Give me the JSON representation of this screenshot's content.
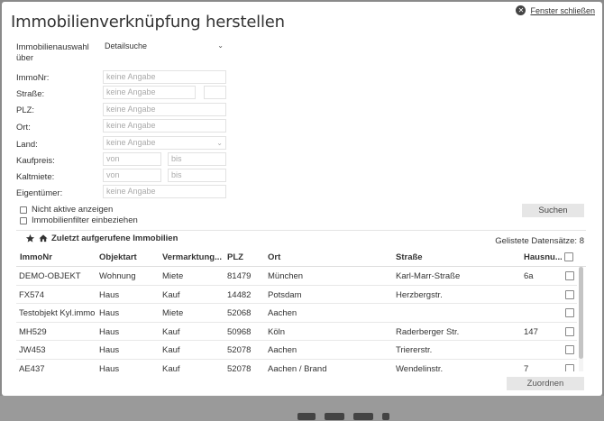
{
  "dialog": {
    "title": "Immobilienverknüpfung herstellen",
    "close_label": "Fenster schließen"
  },
  "form": {
    "selection_label_line1": "Immobilienauswahl",
    "selection_label_line2": "über",
    "selection_value": "Detailsuche",
    "fields": {
      "immonr": {
        "label": "ImmoNr:",
        "placeholder": "keine Angabe"
      },
      "strasse": {
        "label": "Straße:",
        "placeholder": "keine Angabe"
      },
      "plz": {
        "label": "PLZ:",
        "placeholder": "keine Angabe"
      },
      "ort": {
        "label": "Ort:",
        "placeholder": "keine Angabe"
      },
      "land": {
        "label": "Land:",
        "placeholder": "keine Angabe"
      },
      "kaufpreis": {
        "label": "Kaufpreis:",
        "from": "von",
        "to": "bis"
      },
      "kaltmiete": {
        "label": "Kaltmiete:",
        "from": "von",
        "to": "bis"
      },
      "eigentuemer": {
        "label": "Eigentümer:",
        "placeholder": "keine Angabe"
      }
    },
    "checkboxes": {
      "inactive": "Nicht aktive anzeigen",
      "filter": "Immobilienfilter einbeziehen"
    },
    "search_button": "Suchen"
  },
  "results": {
    "heading": "Zuletzt aufgerufene Immobilien",
    "count_label": "Gelistete Datensätze: 8",
    "columns": [
      "ImmoNr",
      "Objektart",
      "Vermarktung...",
      "PLZ",
      "Ort",
      "Straße",
      "Hausnu..."
    ],
    "rows": [
      [
        "DEMO-OBJEKT",
        "Wohnung",
        "Miete",
        "81479",
        "München",
        "Karl-Marr-Straße",
        "6a"
      ],
      [
        "FX574",
        "Haus",
        "Kauf",
        "14482",
        "Potsdam",
        "Herzbergstr.",
        ""
      ],
      [
        "Testobjekt Kyl.immo",
        "Haus",
        "Miete",
        "52068",
        "Aachen",
        "",
        ""
      ],
      [
        "MH529",
        "Haus",
        "Kauf",
        "50968",
        "Köln",
        "Raderberger Str.",
        "147"
      ],
      [
        "JW453",
        "Haus",
        "Kauf",
        "52078",
        "Aachen",
        "Triererstr.",
        ""
      ],
      [
        "AE437",
        "Haus",
        "Kauf",
        "52078",
        "Aachen / Brand",
        "Wendelinstr.",
        "7"
      ]
    ]
  },
  "footer": {
    "assign_button": "Zuordnen"
  }
}
